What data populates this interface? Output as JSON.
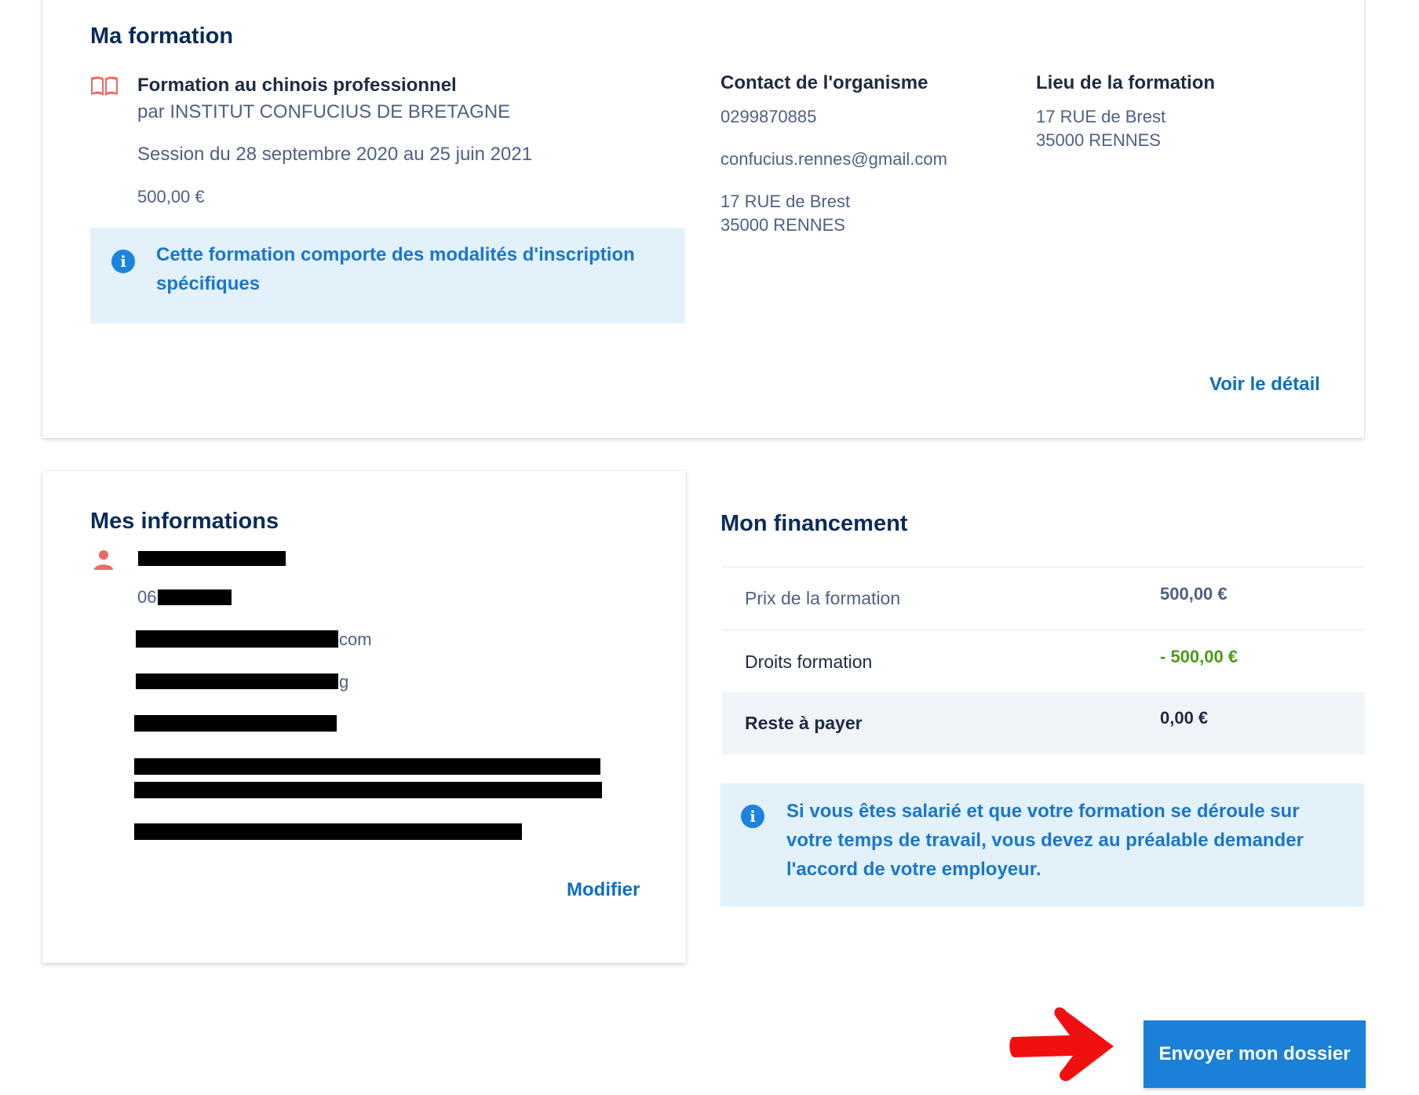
{
  "formation_card": {
    "title": "Ma formation",
    "course_title": "Formation au chinois professionnel",
    "provider": "par INSTITUT CONFUCIUS DE BRETAGNE",
    "session": "Session du 28 septembre 2020 au 25 juin 2021",
    "price": "500,00 €",
    "notice": "Cette formation comporte des modalités d'inscription spécifiques",
    "contact": {
      "heading": "Contact de l'organisme",
      "phone": "0299870885",
      "email": "confucius.rennes@gmail.com",
      "address_line1": "17 RUE de Brest",
      "address_line2": "35000 RENNES"
    },
    "location": {
      "heading": "Lieu de la formation",
      "address_line1": "17 RUE de Brest",
      "address_line2": "35000 RENNES"
    },
    "detail_link": "Voir le détail"
  },
  "infos_card": {
    "title": "Mes informations",
    "phone_prefix": "06",
    "email_suffix": "com",
    "line3_suffix": "g",
    "modify_label": "Modifier"
  },
  "financing": {
    "title": "Mon financement",
    "rows": [
      {
        "label": "Prix de la formation",
        "value": "500,00 €"
      },
      {
        "label": "Droits formation",
        "value": "- 500,00 €"
      },
      {
        "label": "Reste à payer",
        "value": "0,00 €"
      }
    ],
    "notice": "Si vous êtes salarié et que votre formation se déroule sur votre temps de travail, vous devez au préalable demander l'accord de votre employeur."
  },
  "submit_label": "Envoyer mon dossier",
  "colors": {
    "primary": "#1a80d8",
    "title": "#0b2a5b",
    "negative_amount": "#4a9a1b",
    "info_bg": "#e3f1fb",
    "icon_accent": "#ec6a63"
  },
  "icons": {
    "book": "book-icon",
    "info": "info-icon",
    "person": "person-icon",
    "arrow": "arrow-right-icon"
  }
}
